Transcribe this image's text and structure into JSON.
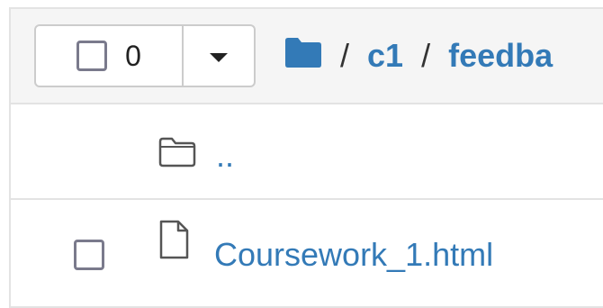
{
  "toolbar": {
    "selected_count": "0"
  },
  "breadcrumb": {
    "separator": "/",
    "items": [
      "c1",
      "feedba"
    ]
  },
  "file_list": {
    "parent_link": "..",
    "files": [
      {
        "name": "Coursework_1.html",
        "icon": "file-icon",
        "checked": false
      }
    ]
  },
  "colors": {
    "link": "#337ab7",
    "header_bg": "#f5f5f5",
    "border": "#e3e3e3",
    "checkbox_border": "#7a7a8c"
  }
}
